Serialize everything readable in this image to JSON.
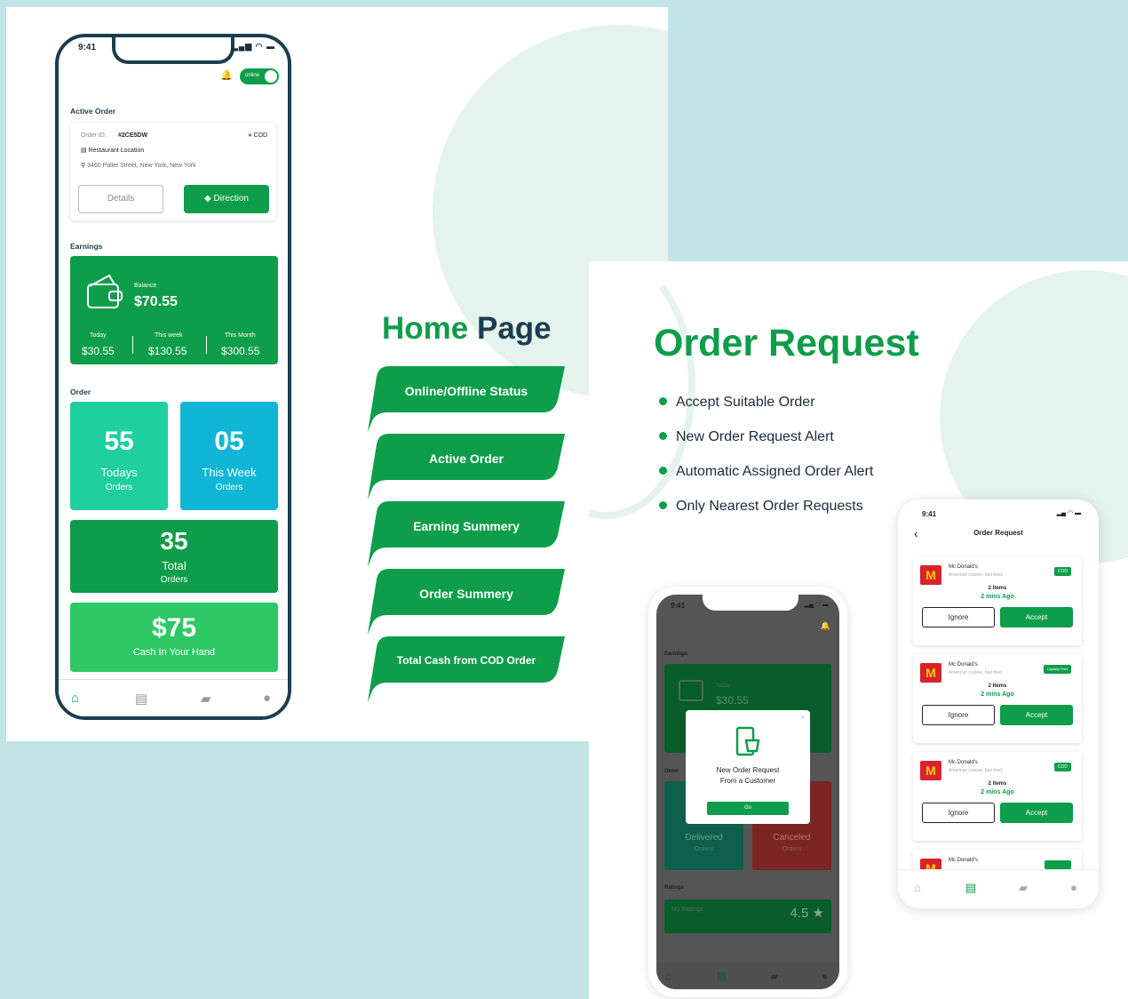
{
  "home_phone": {
    "status_time": "9:41",
    "online_toggle": "online",
    "active_order": {
      "section_title": "Active Order",
      "order_id_label": "Order ID:",
      "order_id": "#2CE5DW",
      "payment": "COD",
      "restaurant": "Restaurant Location",
      "address": "3460 Pallet Street, New York, New York",
      "details_btn": "Details",
      "direction_btn": "Direction"
    },
    "earnings": {
      "section_title": "Earnings",
      "balance_label": "Balance",
      "balance": "$70.55",
      "today_label": "Today",
      "today": "$30.55",
      "week_label": "This week",
      "week": "$130.55",
      "month_label": "This Month",
      "month": "$300.55"
    },
    "order": {
      "section_title": "Order",
      "todays_value": "55",
      "todays_label": "Todays",
      "todays_sub": "Orders",
      "week_value": "05",
      "week_label": "This Week",
      "week_sub": "Orders",
      "total_value": "35",
      "total_label": "Total",
      "total_sub": "Orders",
      "cash_value": "$75",
      "cash_label": "Cash In Your Hand"
    }
  },
  "home_page": {
    "title_a": "Home",
    "title_b": "Page",
    "features": [
      "Online/Offline Status",
      "Active Order",
      "Earning Summery",
      "Order Summery",
      "Total Cash from COD Order"
    ]
  },
  "order_request": {
    "title": "Order Request",
    "bullets": [
      "Accept Suitable Order",
      "New Order Request Alert",
      "Automatic Assigned Order Alert",
      "Only Nearest Order Requests"
    ]
  },
  "alert_phone": {
    "status_time": "9:41",
    "earnings_title": "Earnings",
    "today_label": "Today",
    "balance": "$30.55",
    "order_title": "Order",
    "delivered_label": "Delivered",
    "delivered_sub": "Orders",
    "canceled_label": "Canceled",
    "canceled_sub": "Orders",
    "ratings_title": "Ratings",
    "my_ratings": "My Ratings",
    "rating": "4.5",
    "modal_line1": "New Order Request",
    "modal_line2": "From a Customer",
    "modal_btn": "Go"
  },
  "request_phone": {
    "status_time": "9:41",
    "title": "Order Request",
    "requests": [
      {
        "name": "Mc Donald's",
        "sub": "American cuisine, fast food",
        "badge": "COD",
        "items": "2 Items",
        "time": "2 mins Ago",
        "ignore": "Ignore",
        "accept": "Accept"
      },
      {
        "name": "Mc Donald's",
        "sub": "American cuisine, fast food",
        "badge": "Digitally Paid",
        "items": "2 Items",
        "time": "2 mins Ago",
        "ignore": "Ignore",
        "accept": "Accept"
      },
      {
        "name": "Mc Donald's",
        "sub": "American cuisine, fast food",
        "badge": "COD",
        "items": "2 Items",
        "time": "2 mins Ago",
        "ignore": "Ignore",
        "accept": "Accept"
      }
    ],
    "partial_name": "Mc Donald's"
  },
  "colors": {
    "brand_green": "#0e9d4a",
    "teal": "#1fcf9f",
    "blue": "#11b6d6",
    "navy": "#1c3d4f"
  }
}
